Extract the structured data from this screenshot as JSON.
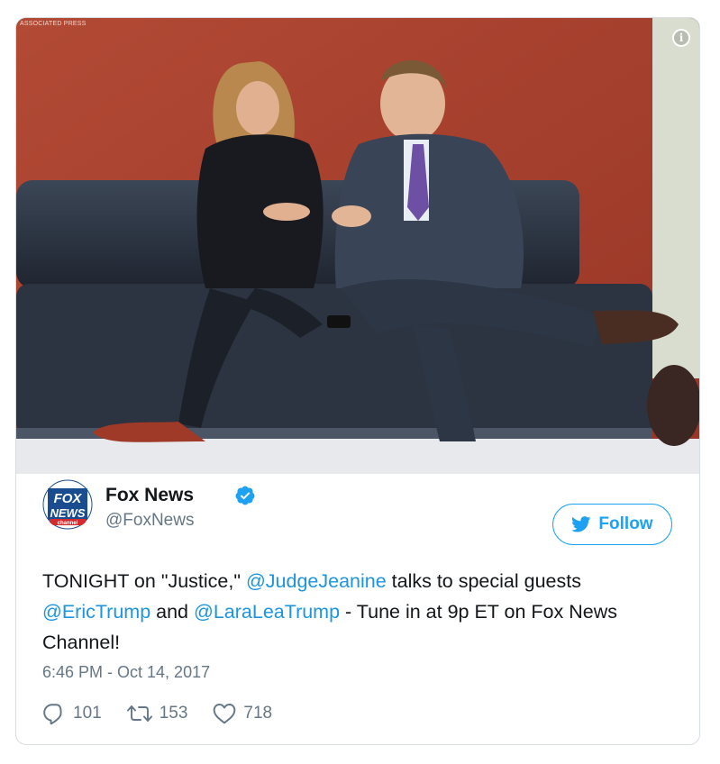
{
  "media": {
    "credit": "ASSOCIATED PRESS",
    "info_icon": "info-circle-icon",
    "info_glyph": "i"
  },
  "author": {
    "display_name": "Fox News",
    "handle": "@FoxNews",
    "verified_icon": "verified-badge-icon",
    "logo": {
      "line1": "FOX",
      "line2": "NEWS",
      "line3": "channel"
    }
  },
  "follow": {
    "label": "Follow",
    "icon": "twitter-bird-icon",
    "color": "#1da1f2"
  },
  "tweet": {
    "parts": [
      {
        "type": "text",
        "value": "TONIGHT on \"Justice,\" "
      },
      {
        "type": "mention",
        "value": "@JudgeJeanine"
      },
      {
        "type": "text",
        "value": " talks to special guests "
      },
      {
        "type": "mention",
        "value": "@EricTrump"
      },
      {
        "type": "text",
        "value": " and "
      },
      {
        "type": "mention",
        "value": "@LaraLeaTrump"
      },
      {
        "type": "text",
        "value": " - Tune in at 9p ET on Fox News Channel!"
      }
    ],
    "timestamp": "6:46 PM - Oct 14, 2017"
  },
  "actions": {
    "reply": {
      "icon": "reply-icon",
      "count": "101"
    },
    "retweet": {
      "icon": "retweet-icon",
      "count": "153"
    },
    "like": {
      "icon": "heart-icon",
      "count": "718"
    }
  },
  "colors": {
    "mention": "#1b95e0",
    "secondary_text": "#657786",
    "border": "#d7dde3"
  }
}
